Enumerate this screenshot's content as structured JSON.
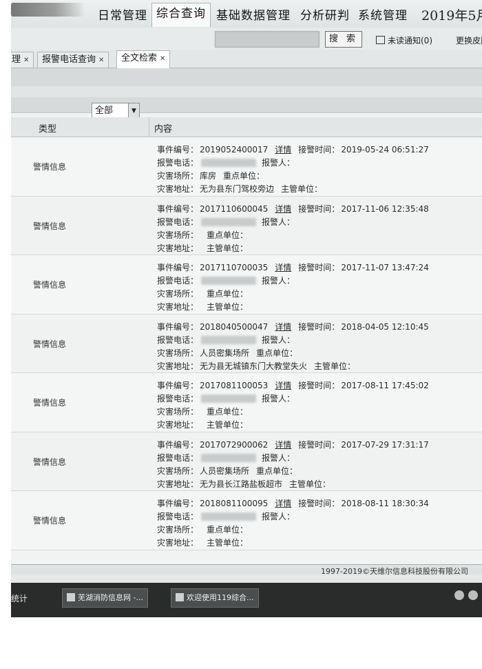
{
  "nav": {
    "items": [
      "日常管理",
      "综合查询",
      "基础数据管理",
      "分析研判",
      "系统管理"
    ],
    "date": "2019年5月"
  },
  "search": {
    "button": "搜 索",
    "notify": "未读通知(0)",
    "skin": "更换皮肤"
  },
  "tabs": [
    {
      "label": "理"
    },
    {
      "label": "报警电话查询"
    },
    {
      "label": "全文检索"
    }
  ],
  "filter": {
    "selected": "全部"
  },
  "grid": {
    "col_type": "类型",
    "col_content": "内容"
  },
  "labels": {
    "event_no": "事件编号：",
    "detail": "详情",
    "alarm_time": "接警时间：",
    "phone": "报警电话：",
    "reporter": "报警人：",
    "place": "灾害场所：",
    "key_unit": "重点单位：",
    "address": "灾害地址：",
    "manager": "主管单位："
  },
  "records": [
    {
      "type": "警情信息",
      "id": "2019052400017",
      "time": "2019-05-24 06:51:27",
      "place": "库房",
      "address": "无为县东门驾校旁边"
    },
    {
      "type": "警情信息",
      "id": "2017110600045",
      "time": "2017-11-06 12:35:48",
      "place": "",
      "address": ""
    },
    {
      "type": "警情信息",
      "id": "2017110700035",
      "time": "2017-11-07 13:47:24",
      "place": "",
      "address": ""
    },
    {
      "type": "警情信息",
      "id": "2018040500047",
      "time": "2018-04-05 12:10:45",
      "place": "人员密集场所",
      "address": "无为县无城镇东门大教堂失火"
    },
    {
      "type": "警情信息",
      "id": "2017081100053",
      "time": "2017-08-11 17:45:02",
      "place": "",
      "address": ""
    },
    {
      "type": "警情信息",
      "id": "2017072900062",
      "time": "2017-07-29 17:31:17",
      "place": "人员密集场所",
      "address": "无为县长江路盐板超市"
    },
    {
      "type": "警情信息",
      "id": "2018081100095",
      "time": "2018-08-11 18:30:34",
      "place": "",
      "address": ""
    }
  ],
  "footer": {
    "copyright": "1997-2019©天维尔信息科技股份有限公司"
  },
  "taskbar": {
    "left": "统计",
    "buttons": [
      "芜湖消防信息网 -...",
      "欢迎使用119综合..."
    ]
  }
}
